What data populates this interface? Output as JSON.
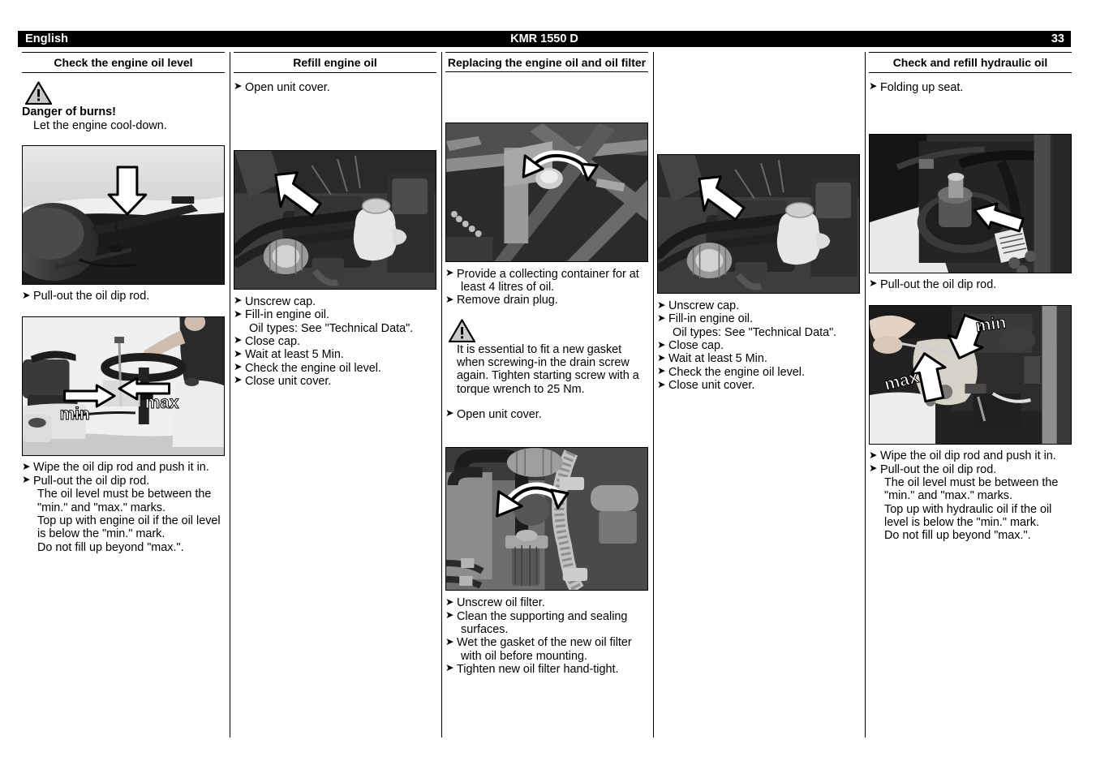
{
  "header": {
    "language": "English",
    "model": "KMR 1550 D",
    "page_number": "33"
  },
  "bullet_marker": "➤",
  "columns": [
    {
      "id": "check-engine-oil-level",
      "title": "Check the engine oil level",
      "warning": {
        "icon": "warning-triangle-icon",
        "title": "Danger of burns!",
        "body": "Let the engine cool-down."
      },
      "photo1": {
        "name": "photo-seat-dipstick-location",
        "arrow": "down-arrow",
        "labels": []
      },
      "steps1": [
        {
          "text": "Pull-out the oil dip rod.",
          "subs": []
        }
      ],
      "photo2": {
        "name": "photo-dipstick-min-max-marks",
        "arrow": "left-right-arrows",
        "labels": [
          "min",
          "max"
        ]
      },
      "steps2": [
        {
          "text": "Wipe the oil dip rod and push it in.",
          "subs": []
        },
        {
          "text": "Pull-out the oil dip rod.",
          "subs": [
            "The oil level must be between the",
            "\"min.\" and \"max.\" marks.",
            "Top up with engine oil if the oil level",
            "is below the \"min.\" mark.",
            "Do not fill up beyond \"max.\"."
          ]
        }
      ]
    },
    {
      "id": "refill-engine-oil",
      "title": "Refill engine oil",
      "steps1": [
        {
          "text": "Open unit cover.",
          "subs": []
        }
      ],
      "photo1": {
        "name": "photo-engine-bay-oil-cap",
        "arrow": "diagonal-down-right-arrow",
        "labels": []
      },
      "steps2": [
        {
          "text": "Unscrew cap.",
          "subs": []
        },
        {
          "text": "Fill-in engine oil.",
          "subs": [
            "Oil types: See \"Technical Data\"."
          ]
        },
        {
          "text": "Close cap.",
          "subs": []
        },
        {
          "text": "Wait at least 5 Min.",
          "subs": []
        },
        {
          "text": "Check the engine oil level.",
          "subs": []
        },
        {
          "text": "Close unit cover.",
          "subs": []
        }
      ]
    },
    {
      "id": "replacing-engine-oil-and-oil-filter",
      "title": "Replacing the engine oil and oil filter",
      "photo1": {
        "name": "photo-drain-plug-underside",
        "arrow": "curved-counterclockwise-arrow",
        "labels": []
      },
      "steps1": [
        {
          "text": "Provide a collecting container for at",
          "subs": [
            "least 4 litres of oil."
          ]
        },
        {
          "text": "Remove drain plug.",
          "subs": []
        }
      ],
      "warning": {
        "icon": "warning-triangle-icon",
        "title": "",
        "lines": [
          "It is essential to fit a new gasket",
          "when screwing-in the drain screw",
          "again.",
          "Tighten starting screw with a torque",
          "wrench to 25 Nm."
        ]
      },
      "steps2": [
        {
          "text": "Open unit cover.",
          "subs": []
        }
      ],
      "photo2": {
        "name": "photo-oil-filter-location",
        "arrow": "curved-counterclockwise-arrow",
        "labels": []
      },
      "steps3": [
        {
          "text": "Unscrew oil filter.",
          "subs": []
        },
        {
          "text": "Clean the supporting and sealing",
          "subs": [
            "surfaces."
          ]
        },
        {
          "text": "Wet the gasket of the new oil filter",
          "subs": [
            "with oil before mounting."
          ]
        },
        {
          "text": "Tighten new oil filter hand-tight.",
          "subs": []
        }
      ]
    },
    {
      "id": "refill-engine-oil-continued",
      "title": "",
      "photo1": {
        "name": "photo-engine-bay-oil-cap-continued",
        "arrow": "diagonal-down-right-arrow",
        "labels": []
      },
      "steps2": [
        {
          "text": "Unscrew cap.",
          "subs": []
        },
        {
          "text": "Fill-in engine oil.",
          "subs": [
            "Oil types: See \"Technical Data\"."
          ]
        },
        {
          "text": "Close cap.",
          "subs": []
        },
        {
          "text": "Wait at least 5 Min.",
          "subs": []
        },
        {
          "text": "Check the engine oil level.",
          "subs": []
        },
        {
          "text": "Close unit cover.",
          "subs": []
        }
      ]
    },
    {
      "id": "check-and-refill-hydraulic-oil",
      "title": "Check and refill hydraulic oil",
      "steps1": [
        {
          "text": "Folding up seat.",
          "subs": []
        }
      ],
      "photo1": {
        "name": "photo-hydraulic-tank-dipstick",
        "arrow": "diagonal-left-arrow",
        "labels": []
      },
      "steps2": [
        {
          "text": "Pull-out the oil dip rod.",
          "subs": []
        }
      ],
      "photo2": {
        "name": "photo-hydraulic-dipstick-min-max",
        "arrow": "two-diagonal-arrows",
        "labels": [
          "min",
          "max"
        ]
      },
      "steps3": [
        {
          "text": "Wipe the oil dip rod and push it in.",
          "subs": []
        },
        {
          "text": "Pull-out the oil dip rod.",
          "subs": [
            "The oil level must be between the",
            "\"min.\" and \"max.\" marks.",
            "Top up with hydraulic oil if the oil",
            "level is below the \"min.\" mark.",
            "Do not fill up beyond \"max.\"."
          ]
        }
      ]
    }
  ]
}
